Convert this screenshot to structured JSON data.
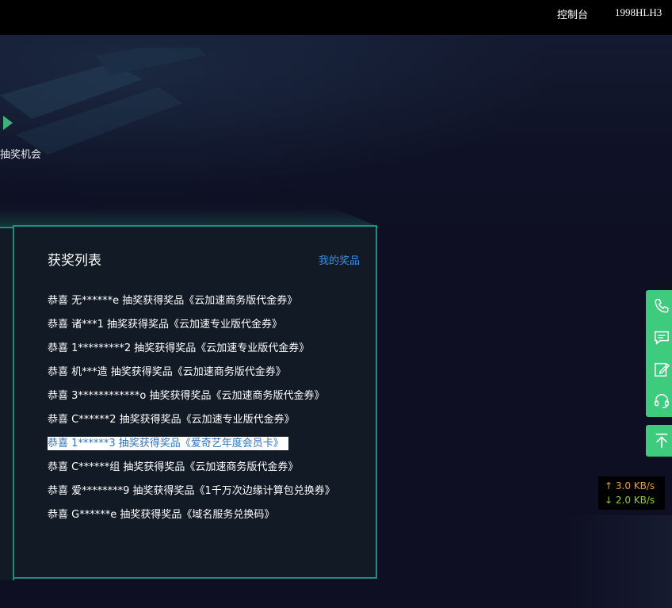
{
  "topbar": {
    "console": "控制台",
    "user": "1998HLH3"
  },
  "hero": {
    "chance_text": "抽奖机会"
  },
  "panel": {
    "title": "获奖列表",
    "my_prizes": "我的奖品",
    "winners": [
      "恭喜 无******e 抽奖获得奖品《云加速商务版代金券》",
      "恭喜 诸***1 抽奖获得奖品《云加速专业版代金券》",
      "恭喜 1*********2 抽奖获得奖品《云加速专业版代金券》",
      "恭喜 机***造 抽奖获得奖品《云加速商务版代金券》",
      "恭喜 3************o 抽奖获得奖品《云加速商务版代金券》",
      "恭喜 C******2 抽奖获得奖品《云加速专业版代金券》",
      "恭喜 1******3 抽奖获得奖品《爱奇艺年度会员卡》",
      "恭喜 C******组 抽奖获得奖品《云加速商务版代金券》",
      "恭喜 爱********9 抽奖获得奖品《1千万次边缘计算包兑换券》",
      "恭喜 G******e 抽奖获得奖品《域名服务兑换码》"
    ]
  },
  "side_tools": {
    "icons": [
      "phone-icon",
      "chat-icon",
      "edit-icon",
      "headset-icon"
    ],
    "back_top_icon": "arrow-up-icon"
  },
  "speed": {
    "up": "↑ 3.0 KB/s",
    "down": "↓ 2.0 KB/s"
  },
  "colors": {
    "accent_green": "#3ecb7d",
    "panel_border": "#1f8f82",
    "link_blue": "#3a8ee6"
  }
}
